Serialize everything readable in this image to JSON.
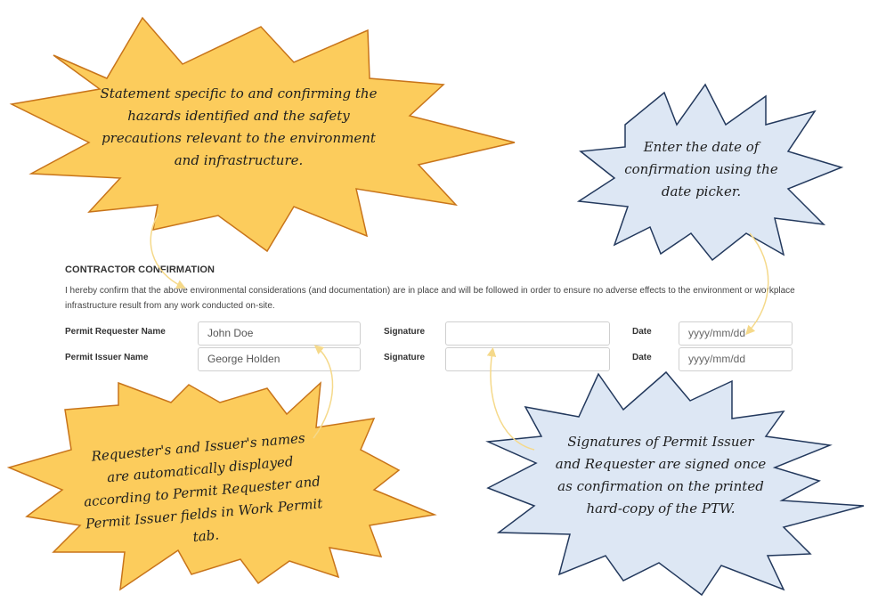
{
  "form": {
    "section_title": "CONTRACTOR CONFIRMATION",
    "statement": "I hereby confirm that the above environmental considerations (and documentation) are in place and will be followed in order to ensure no adverse effects to the environment or workplace infrastructure result from any work conducted on-site.",
    "rows": [
      {
        "name_label": "Permit Requester Name",
        "name_value": "John Doe",
        "signature_label": "Signature",
        "signature_value": "",
        "date_label": "Date",
        "date_placeholder": "yyyy/mm/dd"
      },
      {
        "name_label": "Permit Issuer Name",
        "name_value": "George Holden",
        "signature_label": "Signature",
        "signature_value": "",
        "date_label": "Date",
        "date_placeholder": "yyyy/mm/dd"
      }
    ]
  },
  "callouts": {
    "statement": "Statement specific to and confirming the hazards identified and the safety precautions relevant to the environment and infrastructure.",
    "date": "Enter the date of confirmation using the date picker.",
    "names": "Requester's and Issuer's names are automatically displayed according to Permit Requester and Permit Issuer fields in Work Permit tab.",
    "signatures": "Signatures of Permit Issuer and Requester are signed once as confirmation on the printed hard-copy of the PTW."
  },
  "colors": {
    "yellow_fill": "#fccc5c",
    "yellow_stroke": "#c8741a",
    "blue_fill": "#dde7f4",
    "blue_stroke": "#23395d",
    "arrow": "#f5d98a"
  }
}
